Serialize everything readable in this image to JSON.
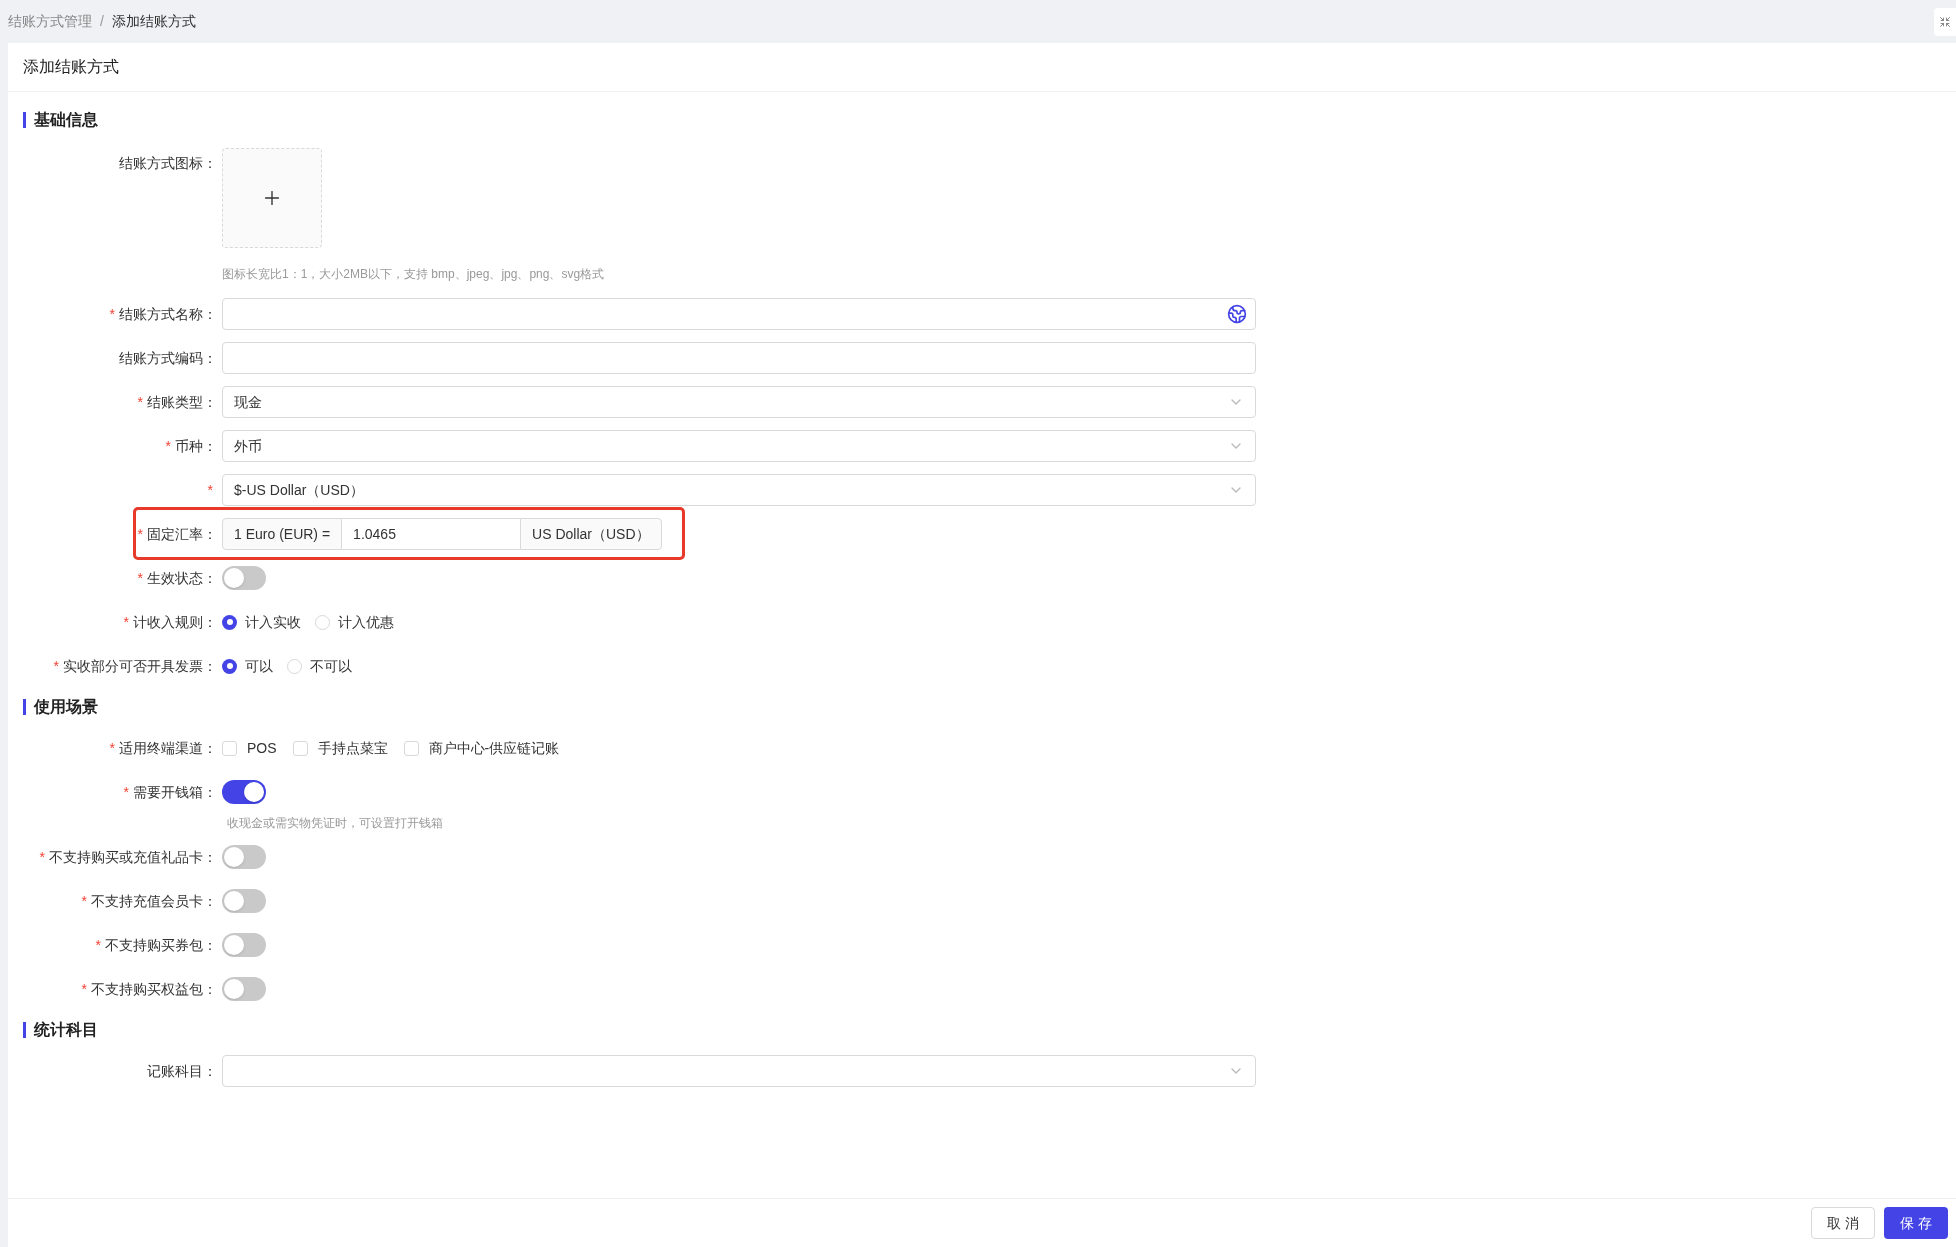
{
  "breadcrumb_separator": "/",
  "breadcrumb": [
    {
      "label": "结账方式管理",
      "current": false
    },
    {
      "label": "添加结账方式",
      "current": true
    }
  ],
  "page_title": "添加结账方式",
  "sections": [
    {
      "title": "基础信息",
      "fields": [
        {
          "kind": "upload",
          "label": "结账方式图标：",
          "hint": "图标长宽比1：1，大小2MB以下，支持 bmp、jpeg、jpg、png、svg格式"
        },
        {
          "kind": "text",
          "label": "结账方式名称：",
          "required_mark": "*",
          "language_icon": true
        },
        {
          "kind": "text",
          "label": "结账方式编码："
        },
        {
          "kind": "select",
          "label": "结账类型：",
          "required_mark": "*",
          "value": "现金"
        },
        {
          "kind": "select",
          "label": "币种：",
          "required_mark": "*",
          "value": "外币"
        },
        {
          "kind": "select",
          "required_mark": "*",
          "value": "$-US Dollar（USD）"
        },
        {
          "kind": "rate",
          "label": "固定汇率：",
          "required_mark": "*",
          "prefix": "1 Euro (EUR) =",
          "value": "1.0465",
          "suffix": "US Dollar（USD）",
          "highlighted": true
        },
        {
          "kind": "switch",
          "label": "生效状态：",
          "required_mark": "*",
          "on": false
        },
        {
          "kind": "radio",
          "label": "计收入规则：",
          "required_mark": "*",
          "options": [
            {
              "label": "计入实收",
              "selected": true
            },
            {
              "label": "计入优惠",
              "selected": false
            }
          ]
        },
        {
          "kind": "radio",
          "label": "实收部分可否开具发票：",
          "required_mark": "*",
          "options": [
            {
              "label": "可以",
              "selected": true
            },
            {
              "label": "不可以",
              "selected": false
            }
          ]
        }
      ]
    },
    {
      "title": "使用场景",
      "fields": [
        {
          "kind": "checkbox",
          "label": "适用终端渠道：",
          "required_mark": "*",
          "options": [
            {
              "label": "POS",
              "checked": false
            },
            {
              "label": "手持点菜宝",
              "checked": false
            },
            {
              "label": "商户中心-供应链记账",
              "checked": false
            }
          ]
        },
        {
          "kind": "switch",
          "label": "需要开钱箱：",
          "required_mark": "*",
          "on": true,
          "hint": "收现金或需实物凭证时，可设置打开钱箱"
        },
        {
          "kind": "switch",
          "label": "不支持购买或充值礼品卡：",
          "required_mark": "*",
          "on": false
        },
        {
          "kind": "switch",
          "label": "不支持充值会员卡：",
          "required_mark": "*",
          "on": false
        },
        {
          "kind": "switch",
          "label": "不支持购买券包：",
          "required_mark": "*",
          "on": false
        },
        {
          "kind": "switch",
          "label": "不支持购买权益包：",
          "required_mark": "*",
          "on": false
        }
      ]
    },
    {
      "title": "统计科目",
      "fields": [
        {
          "kind": "select",
          "label": "记账科目："
        }
      ]
    }
  ],
  "footer_buttons": [
    {
      "label": "取 消",
      "kind": "default"
    },
    {
      "label": "保 存",
      "kind": "primary"
    }
  ]
}
